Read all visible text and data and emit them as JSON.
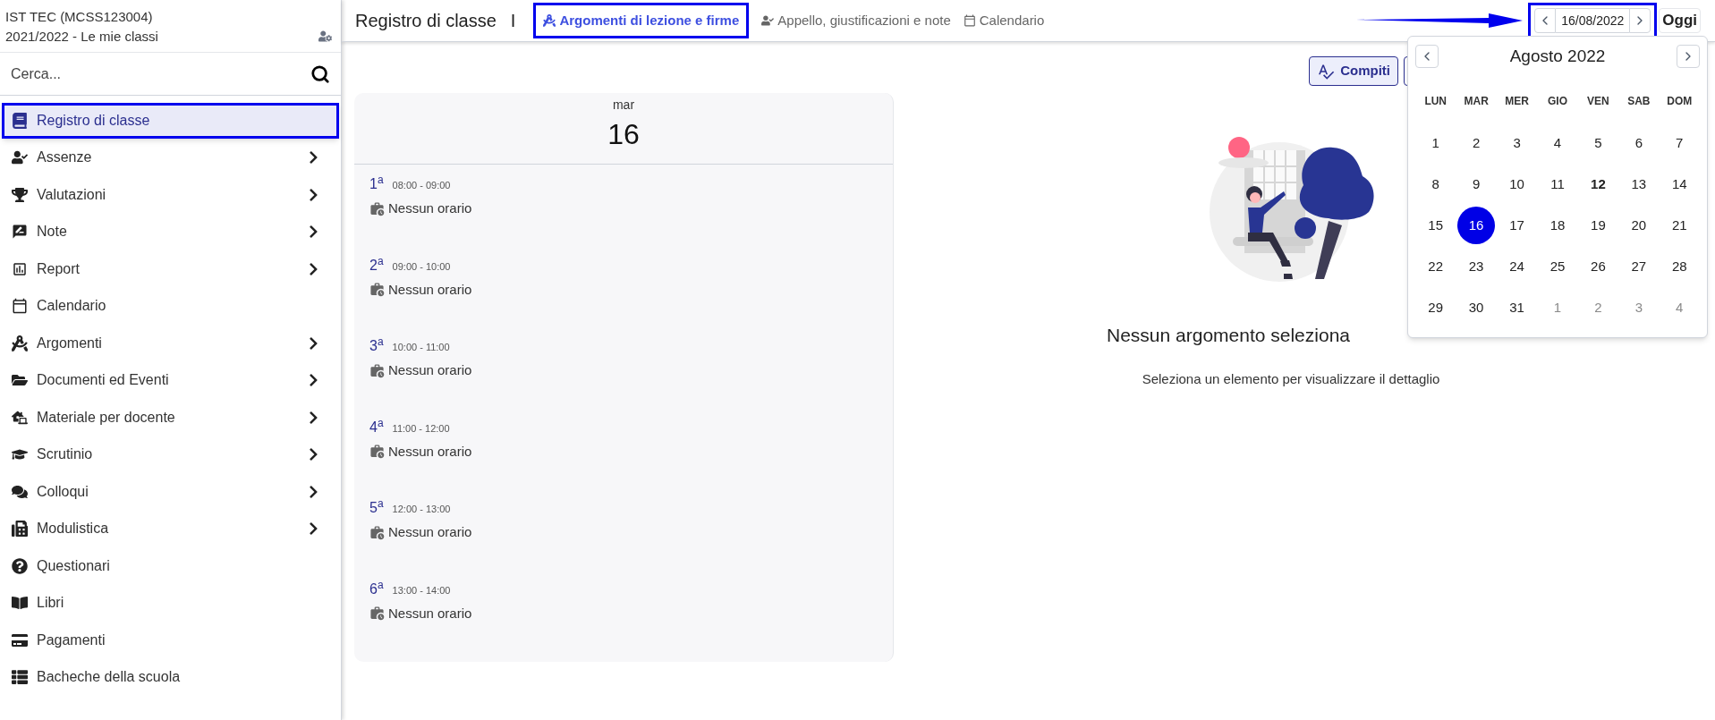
{
  "sidebar": {
    "school": "IST TEC (MCSS123004)",
    "year": "2021/2022 - Le mie classi",
    "search": {
      "placeholder": "Cerca..."
    },
    "items": [
      {
        "label": "Registro di classe",
        "selected": true,
        "expandable": false
      },
      {
        "label": "Assenze",
        "selected": false,
        "expandable": true
      },
      {
        "label": "Valutazioni",
        "selected": false,
        "expandable": true
      },
      {
        "label": "Note",
        "selected": false,
        "expandable": true
      },
      {
        "label": "Report",
        "selected": false,
        "expandable": true
      },
      {
        "label": "Calendario",
        "selected": false,
        "expandable": false
      },
      {
        "label": "Argomenti",
        "selected": false,
        "expandable": true
      },
      {
        "label": "Documenti ed Eventi",
        "selected": false,
        "expandable": true
      },
      {
        "label": "Materiale per docente",
        "selected": false,
        "expandable": true
      },
      {
        "label": "Scrutinio",
        "selected": false,
        "expandable": true
      },
      {
        "label": "Colloqui",
        "selected": false,
        "expandable": true
      },
      {
        "label": "Modulistica",
        "selected": false,
        "expandable": true
      },
      {
        "label": "Questionari",
        "selected": false,
        "expandable": false
      },
      {
        "label": "Libri",
        "selected": false,
        "expandable": false
      },
      {
        "label": "Pagamenti",
        "selected": false,
        "expandable": false
      },
      {
        "label": "Bacheche della scuola",
        "selected": false,
        "expandable": false
      }
    ]
  },
  "topbar": {
    "title": "Registro di classe",
    "separator": "I",
    "tabs": [
      {
        "label": "Argomenti di lezione e firme",
        "selected": true
      },
      {
        "label": "Appello, giustificazioni e note",
        "selected": false
      },
      {
        "label": "Calendario",
        "selected": false
      }
    ],
    "date_picker": {
      "value": "16/08/2022",
      "highlighted": true
    },
    "today_button": "Oggi"
  },
  "toolbar": {
    "homework_button": "Compiti"
  },
  "day": {
    "weekday": "mar",
    "number": "16",
    "periods": [
      {
        "label": "1$^{a}$",
        "time": "08:00 - 09:00",
        "status": "Nessun orario"
      },
      {
        "label": "2$^{a}$",
        "time": "09:00 - 10:00",
        "status": "Nessun orario"
      },
      {
        "label": "3$^{a}$",
        "time": "10:00 - 11:00",
        "status": "Nessun orario"
      },
      {
        "label": "4$^{a}$",
        "time": "11:00 - 12:00",
        "status": "Nessun orario"
      },
      {
        "label": "5$^{a}$",
        "time": "12:00 - 13:00",
        "status": "Nessun orario"
      },
      {
        "label": "6$^{a}$",
        "time": "13:00 - 14:00",
        "status": "Nessun orario"
      }
    ]
  },
  "empty_state": {
    "title": "Nessun argomento seleziona",
    "subtitle": "Seleziona un elemento per visualizzare il dettaglio"
  },
  "calendar_popup": {
    "month": "Agosto 2022",
    "weekdays": [
      "LUN",
      "MAR",
      "MER",
      "GIO",
      "VEN",
      "SAB",
      "DOM"
    ],
    "days": [
      {
        "label": "1",
        "selected": false,
        "today": false,
        "outside": false
      },
      {
        "label": "2",
        "selected": false,
        "today": false,
        "outside": false
      },
      {
        "label": "3",
        "selected": false,
        "today": false,
        "outside": false
      },
      {
        "label": "4",
        "selected": false,
        "today": false,
        "outside": false
      },
      {
        "label": "5",
        "selected": false,
        "today": false,
        "outside": false
      },
      {
        "label": "6",
        "selected": false,
        "today": false,
        "outside": false
      },
      {
        "label": "7",
        "selected": false,
        "today": false,
        "outside": false
      },
      {
        "label": "8",
        "selected": false,
        "today": false,
        "outside": false
      },
      {
        "label": "9",
        "selected": false,
        "today": false,
        "outside": false
      },
      {
        "label": "10",
        "selected": false,
        "today": false,
        "outside": false
      },
      {
        "label": "11",
        "selected": false,
        "today": false,
        "outside": false
      },
      {
        "label": "12",
        "selected": false,
        "today": true,
        "outside": false
      },
      {
        "label": "13",
        "selected": false,
        "today": false,
        "outside": false
      },
      {
        "label": "14",
        "selected": false,
        "today": false,
        "outside": false
      },
      {
        "label": "15",
        "selected": false,
        "today": false,
        "outside": false
      },
      {
        "label": "16",
        "selected": true,
        "today": false,
        "outside": false
      },
      {
        "label": "17",
        "selected": false,
        "today": false,
        "outside": false
      },
      {
        "label": "18",
        "selected": false,
        "today": false,
        "outside": false
      },
      {
        "label": "19",
        "selected": false,
        "today": false,
        "outside": false
      },
      {
        "label": "20",
        "selected": false,
        "today": false,
        "outside": false
      },
      {
        "label": "21",
        "selected": false,
        "today": false,
        "outside": false
      },
      {
        "label": "22",
        "selected": false,
        "today": false,
        "outside": false
      },
      {
        "label": "23",
        "selected": false,
        "today": false,
        "outside": false
      },
      {
        "label": "24",
        "selected": false,
        "today": false,
        "outside": false
      },
      {
        "label": "25",
        "selected": false,
        "today": false,
        "outside": false
      },
      {
        "label": "26",
        "selected": false,
        "today": false,
        "outside": false
      },
      {
        "label": "27",
        "selected": false,
        "today": false,
        "outside": false
      },
      {
        "label": "28",
        "selected": false,
        "today": false,
        "outside": false
      },
      {
        "label": "29",
        "selected": false,
        "today": false,
        "outside": false
      },
      {
        "label": "30",
        "selected": false,
        "today": false,
        "outside": false
      },
      {
        "label": "31",
        "selected": false,
        "today": false,
        "outside": false
      },
      {
        "label": "1",
        "selected": false,
        "today": false,
        "outside": true
      },
      {
        "label": "2",
        "selected": false,
        "today": false,
        "outside": true
      },
      {
        "label": "3",
        "selected": false,
        "today": false,
        "outside": true
      },
      {
        "label": "4",
        "selected": false,
        "today": false,
        "outside": true
      }
    ]
  }
}
